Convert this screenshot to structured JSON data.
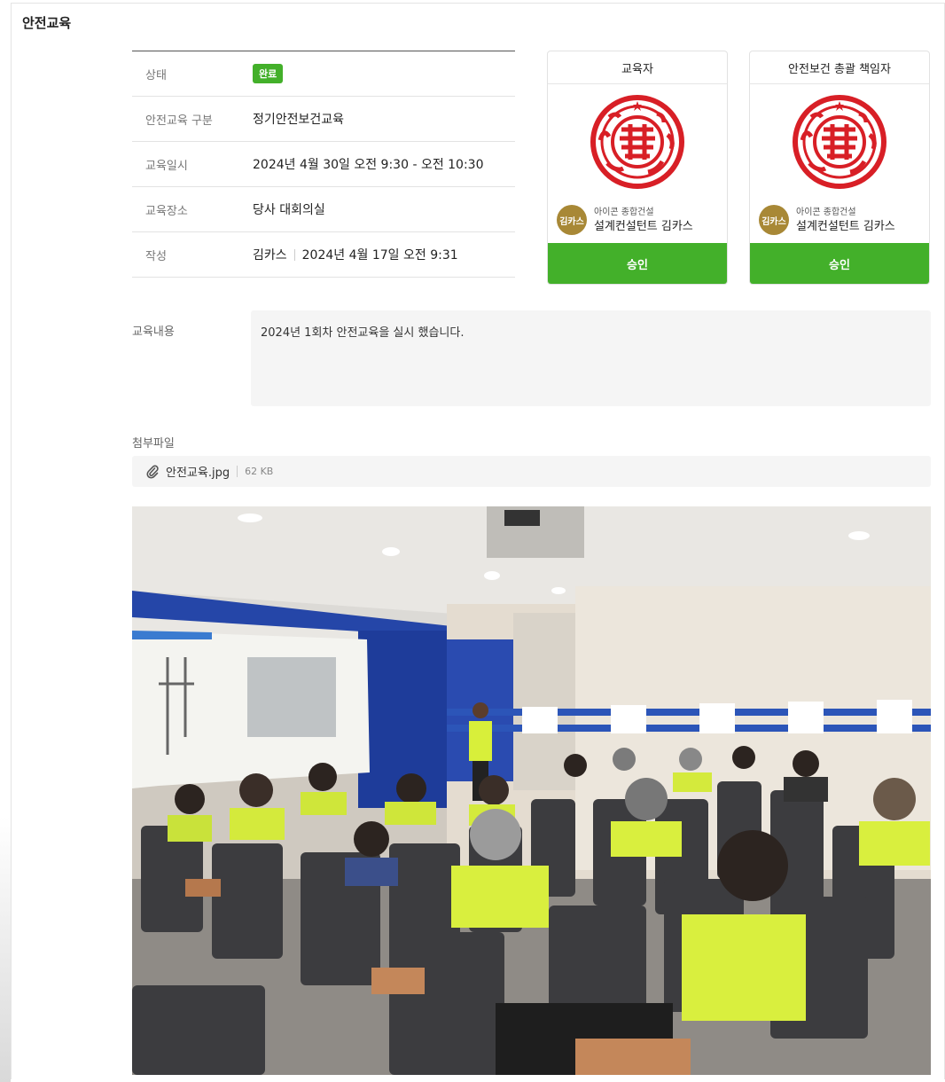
{
  "page_title": "안전교육",
  "info": {
    "status_label": "상태",
    "status_value": "완료",
    "type_label": "안전교육 구분",
    "type_value": "정기안전보건교육",
    "datetime_label": "교육일시",
    "datetime_value": "2024년 4월 30일 오전 9:30 - 오전 10:30",
    "location_label": "교육장소",
    "location_value": "당사 대회의실",
    "author_label": "작성",
    "author_name": "김카스",
    "author_date": "2024년 4월 17일 오전 9:31"
  },
  "cards": [
    {
      "title": "교육자",
      "avatar": "김카스",
      "company": "아이콘 종합건설",
      "name": "설계컨설턴트 김카스",
      "button": "승인"
    },
    {
      "title": "안전보건 총괄 책임자",
      "avatar": "김카스",
      "company": "아이콘 종합건설",
      "name": "설계컨설턴트 김카스",
      "button": "승인"
    }
  ],
  "content": {
    "label": "교육내용",
    "text": "2024년 1회차 안전교육을 실시 했습니다."
  },
  "attachment": {
    "label": "첨부파일",
    "filename": "안전교육.jpg",
    "size": "62 KB"
  },
  "colors": {
    "accent_green": "#43b02a",
    "seal_red": "#d81f26",
    "avatar_gold": "#a88836"
  }
}
